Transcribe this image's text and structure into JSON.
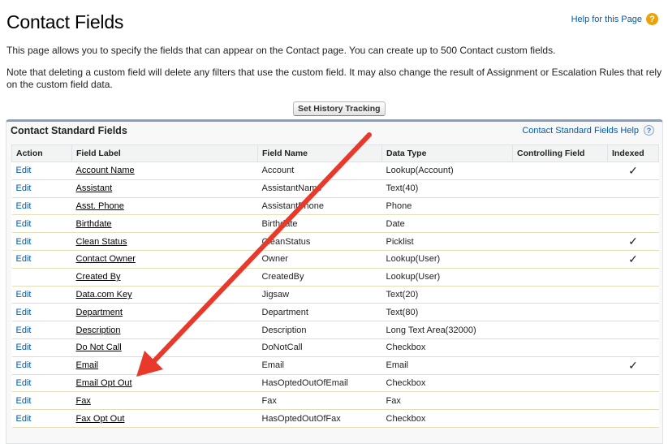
{
  "header": {
    "title": "Contact Fields",
    "help_text": "Help for this Page",
    "help_icon": "question-icon"
  },
  "intro_text": "This page allows you to specify the fields that can appear on the Contact page. You can create up to 500 Contact custom fields.",
  "note_text": "Note that deleting a custom field will delete any filters that use the custom field. It may also change the result of Assignment or Escalation Rules that rely on the custom field data.",
  "toolbar": {
    "history_button": "Set History Tracking"
  },
  "panel": {
    "title": "Contact Standard Fields",
    "help_text": "Contact Standard Fields Help",
    "help_icon": "question-icon"
  },
  "table": {
    "columns": [
      "Action",
      "Field Label",
      "Field Name",
      "Data Type",
      "Controlling Field",
      "Indexed"
    ],
    "rows": [
      {
        "action": "Edit",
        "label": "Account Name",
        "name": "Account",
        "type": "Lookup(Account)",
        "controlling": "",
        "indexed": "✓"
      },
      {
        "action": "Edit",
        "label": "Assistant",
        "name": "AssistantName",
        "type": "Text(40)",
        "controlling": "",
        "indexed": ""
      },
      {
        "action": "Edit",
        "label": "Asst. Phone",
        "name": "AssistantPhone",
        "type": "Phone",
        "controlling": "",
        "indexed": ""
      },
      {
        "action": "Edit",
        "label": "Birthdate",
        "name": "Birthdate",
        "type": "Date",
        "controlling": "",
        "indexed": ""
      },
      {
        "action": "Edit",
        "label": "Clean Status",
        "name": "CleanStatus",
        "type": "Picklist",
        "controlling": "",
        "indexed": "✓"
      },
      {
        "action": "Edit",
        "label": "Contact Owner",
        "name": "Owner",
        "type": "Lookup(User)",
        "controlling": "",
        "indexed": "✓"
      },
      {
        "action": "",
        "label": "Created By",
        "name": "CreatedBy",
        "type": "Lookup(User)",
        "controlling": "",
        "indexed": ""
      },
      {
        "action": "Edit",
        "label": "Data.com Key",
        "name": "Jigsaw",
        "type": "Text(20)",
        "controlling": "",
        "indexed": ""
      },
      {
        "action": "Edit",
        "label": "Department",
        "name": "Department",
        "type": "Text(80)",
        "controlling": "",
        "indexed": ""
      },
      {
        "action": "Edit",
        "label": "Description",
        "name": "Description",
        "type": "Long Text Area(32000)",
        "controlling": "",
        "indexed": ""
      },
      {
        "action": "Edit",
        "label": "Do Not Call",
        "name": "DoNotCall",
        "type": "Checkbox",
        "controlling": "",
        "indexed": ""
      },
      {
        "action": "Edit",
        "label": "Email",
        "name": "Email",
        "type": "Email",
        "controlling": "",
        "indexed": "✓"
      },
      {
        "action": "Edit",
        "label": "Email Opt Out",
        "name": "HasOptedOutOfEmail",
        "type": "Checkbox",
        "controlling": "",
        "indexed": ""
      },
      {
        "action": "Edit",
        "label": "Fax",
        "name": "Fax",
        "type": "Fax",
        "controlling": "",
        "indexed": ""
      },
      {
        "action": "Edit",
        "label": "Fax Opt Out",
        "name": "HasOptedOutOfFax",
        "type": "Checkbox",
        "controlling": "",
        "indexed": ""
      }
    ]
  },
  "annotation": {
    "arrow_color": "#e8392a",
    "accent": "#015ba7"
  }
}
